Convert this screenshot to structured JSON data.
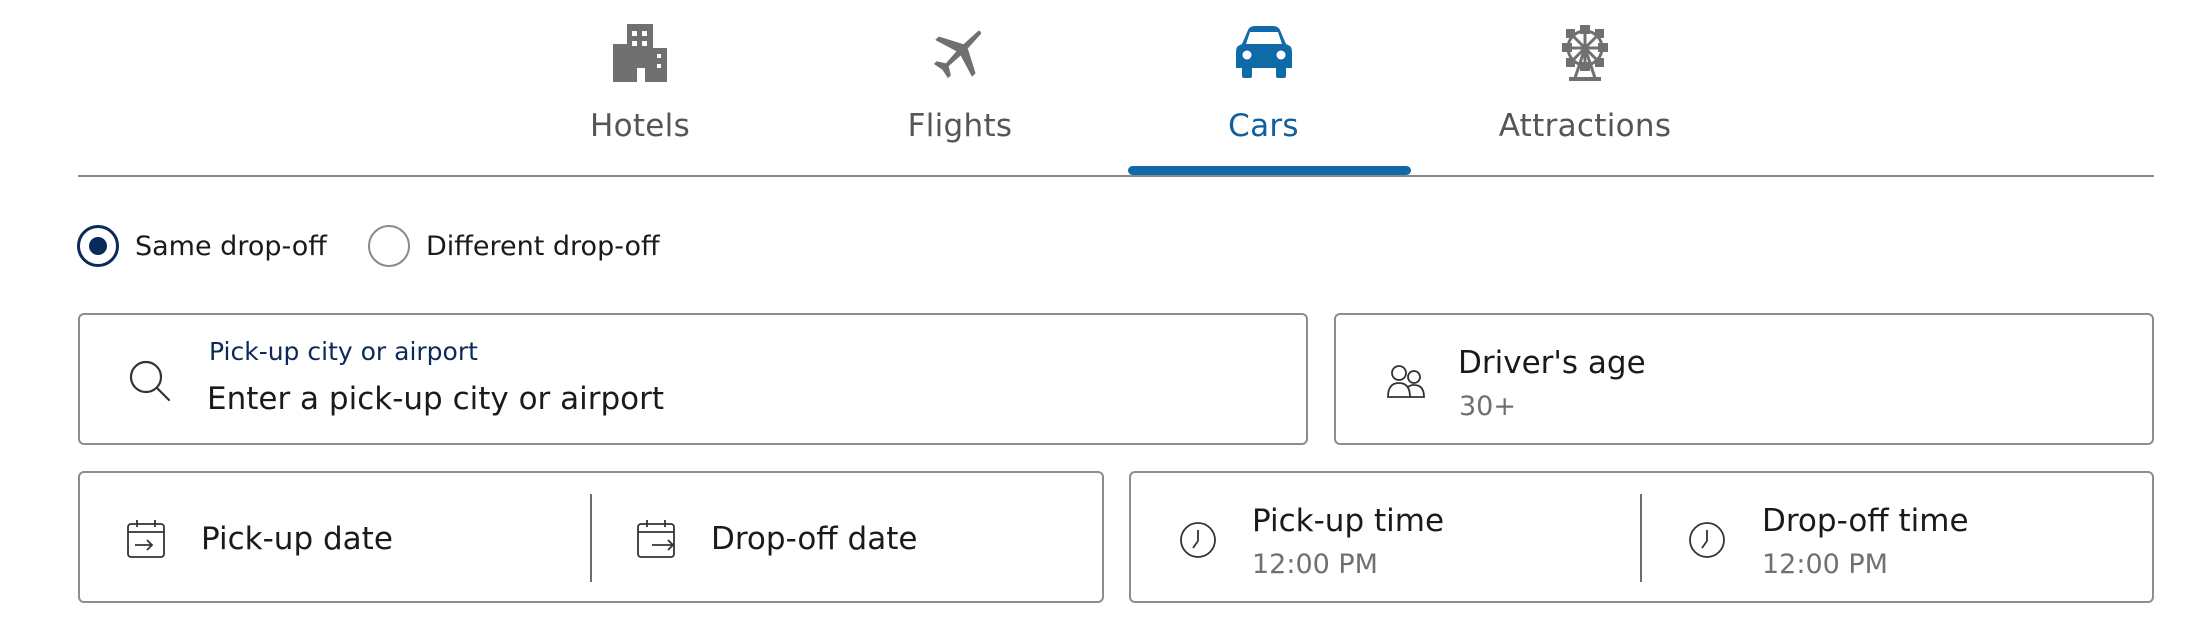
{
  "tabs": [
    {
      "label": "Hotels",
      "icon": "hotel-building-icon",
      "active": false
    },
    {
      "label": "Flights",
      "icon": "airplane-icon",
      "active": false
    },
    {
      "label": "Cars",
      "icon": "car-icon",
      "active": true
    },
    {
      "label": "Attractions",
      "icon": "ferris-wheel-icon",
      "active": false
    }
  ],
  "dropoff_options": {
    "same": {
      "label": "Same drop-off",
      "selected": true
    },
    "different": {
      "label": "Different drop-off",
      "selected": false
    }
  },
  "pickup_location": {
    "label": "Pick-up city or airport",
    "placeholder": "Enter a pick-up city or airport",
    "icon": "search-icon"
  },
  "drivers_age": {
    "label": "Driver's age",
    "value": "30+",
    "icon": "people-icon"
  },
  "dates": {
    "pickup": {
      "label": "Pick-up date",
      "icon": "calendar-in-icon"
    },
    "dropoff": {
      "label": "Drop-off date",
      "icon": "calendar-out-icon"
    }
  },
  "times": {
    "pickup": {
      "label": "Pick-up time",
      "value": "12:00 PM",
      "icon": "clock-icon"
    },
    "dropoff": {
      "label": "Drop-off time",
      "value": "12:00 PM",
      "icon": "clock-icon"
    }
  },
  "colors": {
    "accent": "#0f6aa8",
    "selected_radio": "#0b2a5c",
    "inactive_icon": "#707070",
    "border": "#8d8d8d"
  }
}
